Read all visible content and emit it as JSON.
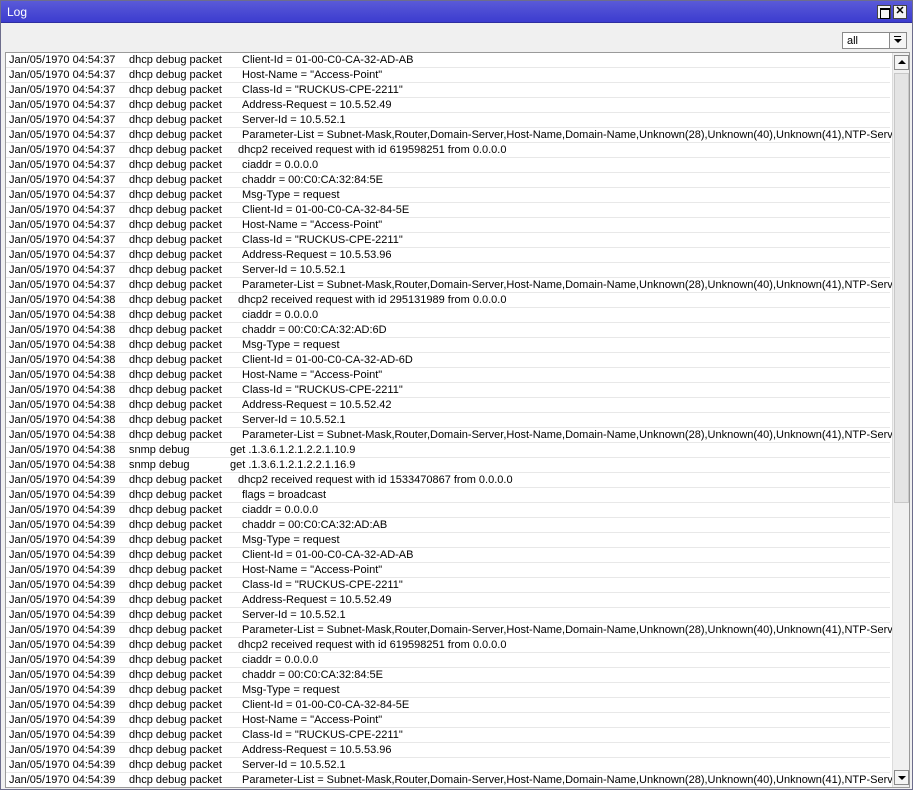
{
  "window": {
    "title": "Log"
  },
  "filter": {
    "value": "all"
  },
  "log": {
    "rows": [
      {
        "time": "Jan/05/1970 04:54:37",
        "topics": "dhcp debug packet",
        "indent": 2,
        "message": "Client-Id = 01-00-C0-CA-32-AD-AB"
      },
      {
        "time": "Jan/05/1970 04:54:37",
        "topics": "dhcp debug packet",
        "indent": 2,
        "message": "Host-Name = \"Access-Point\""
      },
      {
        "time": "Jan/05/1970 04:54:37",
        "topics": "dhcp debug packet",
        "indent": 2,
        "message": "Class-Id = \"RUCKUS-CPE-2211\""
      },
      {
        "time": "Jan/05/1970 04:54:37",
        "topics": "dhcp debug packet",
        "indent": 2,
        "message": "Address-Request = 10.5.52.49"
      },
      {
        "time": "Jan/05/1970 04:54:37",
        "topics": "dhcp debug packet",
        "indent": 2,
        "message": "Server-Id = 10.5.52.1"
      },
      {
        "time": "Jan/05/1970 04:54:37",
        "topics": "dhcp debug packet",
        "indent": 2,
        "message": "Parameter-List = Subnet-Mask,Router,Domain-Server,Host-Name,Domain-Name,Unknown(28),Unknown(40),Unknown(41),NTP-Server"
      },
      {
        "time": "Jan/05/1970 04:54:37",
        "topics": "dhcp debug packet",
        "indent": 1,
        "message": "dhcp2 received request with id 619598251 from 0.0.0.0"
      },
      {
        "time": "Jan/05/1970 04:54:37",
        "topics": "dhcp debug packet",
        "indent": 2,
        "message": "ciaddr = 0.0.0.0"
      },
      {
        "time": "Jan/05/1970 04:54:37",
        "topics": "dhcp debug packet",
        "indent": 2,
        "message": "chaddr = 00:C0:CA:32:84:5E"
      },
      {
        "time": "Jan/05/1970 04:54:37",
        "topics": "dhcp debug packet",
        "indent": 2,
        "message": "Msg-Type = request"
      },
      {
        "time": "Jan/05/1970 04:54:37",
        "topics": "dhcp debug packet",
        "indent": 2,
        "message": "Client-Id = 01-00-C0-CA-32-84-5E"
      },
      {
        "time": "Jan/05/1970 04:54:37",
        "topics": "dhcp debug packet",
        "indent": 2,
        "message": "Host-Name = \"Access-Point\""
      },
      {
        "time": "Jan/05/1970 04:54:37",
        "topics": "dhcp debug packet",
        "indent": 2,
        "message": "Class-Id = \"RUCKUS-CPE-2211\""
      },
      {
        "time": "Jan/05/1970 04:54:37",
        "topics": "dhcp debug packet",
        "indent": 2,
        "message": "Address-Request = 10.5.53.96"
      },
      {
        "time": "Jan/05/1970 04:54:37",
        "topics": "dhcp debug packet",
        "indent": 2,
        "message": "Server-Id = 10.5.52.1"
      },
      {
        "time": "Jan/05/1970 04:54:37",
        "topics": "dhcp debug packet",
        "indent": 2,
        "message": "Parameter-List = Subnet-Mask,Router,Domain-Server,Host-Name,Domain-Name,Unknown(28),Unknown(40),Unknown(41),NTP-Server"
      },
      {
        "time": "Jan/05/1970 04:54:38",
        "topics": "dhcp debug packet",
        "indent": 1,
        "message": "dhcp2 received request with id 295131989 from 0.0.0.0"
      },
      {
        "time": "Jan/05/1970 04:54:38",
        "topics": "dhcp debug packet",
        "indent": 2,
        "message": "ciaddr = 0.0.0.0"
      },
      {
        "time": "Jan/05/1970 04:54:38",
        "topics": "dhcp debug packet",
        "indent": 2,
        "message": "chaddr = 00:C0:CA:32:AD:6D"
      },
      {
        "time": "Jan/05/1970 04:54:38",
        "topics": "dhcp debug packet",
        "indent": 2,
        "message": "Msg-Type = request"
      },
      {
        "time": "Jan/05/1970 04:54:38",
        "topics": "dhcp debug packet",
        "indent": 2,
        "message": "Client-Id = 01-00-C0-CA-32-AD-6D"
      },
      {
        "time": "Jan/05/1970 04:54:38",
        "topics": "dhcp debug packet",
        "indent": 2,
        "message": "Host-Name = \"Access-Point\""
      },
      {
        "time": "Jan/05/1970 04:54:38",
        "topics": "dhcp debug packet",
        "indent": 2,
        "message": "Class-Id = \"RUCKUS-CPE-2211\""
      },
      {
        "time": "Jan/05/1970 04:54:38",
        "topics": "dhcp debug packet",
        "indent": 2,
        "message": "Address-Request = 10.5.52.42"
      },
      {
        "time": "Jan/05/1970 04:54:38",
        "topics": "dhcp debug packet",
        "indent": 2,
        "message": "Server-Id = 10.5.52.1"
      },
      {
        "time": "Jan/05/1970 04:54:38",
        "topics": "dhcp debug packet",
        "indent": 2,
        "message": "Parameter-List = Subnet-Mask,Router,Domain-Server,Host-Name,Domain-Name,Unknown(28),Unknown(40),Unknown(41),NTP-Server"
      },
      {
        "time": "Jan/05/1970 04:54:38",
        "topics": "snmp debug",
        "indent": 0,
        "message": "get .1.3.6.1.2.1.2.2.1.10.9"
      },
      {
        "time": "Jan/05/1970 04:54:38",
        "topics": "snmp debug",
        "indent": 0,
        "message": "get .1.3.6.1.2.1.2.2.1.16.9"
      },
      {
        "time": "Jan/05/1970 04:54:39",
        "topics": "dhcp debug packet",
        "indent": 1,
        "message": "dhcp2 received request with id 1533470867 from 0.0.0.0"
      },
      {
        "time": "Jan/05/1970 04:54:39",
        "topics": "dhcp debug packet",
        "indent": 2,
        "message": "flags = broadcast"
      },
      {
        "time": "Jan/05/1970 04:54:39",
        "topics": "dhcp debug packet",
        "indent": 2,
        "message": "ciaddr = 0.0.0.0"
      },
      {
        "time": "Jan/05/1970 04:54:39",
        "topics": "dhcp debug packet",
        "indent": 2,
        "message": "chaddr = 00:C0:CA:32:AD:AB"
      },
      {
        "time": "Jan/05/1970 04:54:39",
        "topics": "dhcp debug packet",
        "indent": 2,
        "message": "Msg-Type = request"
      },
      {
        "time": "Jan/05/1970 04:54:39",
        "topics": "dhcp debug packet",
        "indent": 2,
        "message": "Client-Id = 01-00-C0-CA-32-AD-AB"
      },
      {
        "time": "Jan/05/1970 04:54:39",
        "topics": "dhcp debug packet",
        "indent": 2,
        "message": "Host-Name = \"Access-Point\""
      },
      {
        "time": "Jan/05/1970 04:54:39",
        "topics": "dhcp debug packet",
        "indent": 2,
        "message": "Class-Id = \"RUCKUS-CPE-2211\""
      },
      {
        "time": "Jan/05/1970 04:54:39",
        "topics": "dhcp debug packet",
        "indent": 2,
        "message": "Address-Request = 10.5.52.49"
      },
      {
        "time": "Jan/05/1970 04:54:39",
        "topics": "dhcp debug packet",
        "indent": 2,
        "message": "Server-Id = 10.5.52.1"
      },
      {
        "time": "Jan/05/1970 04:54:39",
        "topics": "dhcp debug packet",
        "indent": 2,
        "message": "Parameter-List = Subnet-Mask,Router,Domain-Server,Host-Name,Domain-Name,Unknown(28),Unknown(40),Unknown(41),NTP-Server"
      },
      {
        "time": "Jan/05/1970 04:54:39",
        "topics": "dhcp debug packet",
        "indent": 1,
        "message": "dhcp2 received request with id 619598251 from 0.0.0.0"
      },
      {
        "time": "Jan/05/1970 04:54:39",
        "topics": "dhcp debug packet",
        "indent": 2,
        "message": "ciaddr = 0.0.0.0"
      },
      {
        "time": "Jan/05/1970 04:54:39",
        "topics": "dhcp debug packet",
        "indent": 2,
        "message": "chaddr = 00:C0:CA:32:84:5E"
      },
      {
        "time": "Jan/05/1970 04:54:39",
        "topics": "dhcp debug packet",
        "indent": 2,
        "message": "Msg-Type = request"
      },
      {
        "time": "Jan/05/1970 04:54:39",
        "topics": "dhcp debug packet",
        "indent": 2,
        "message": "Client-Id = 01-00-C0-CA-32-84-5E"
      },
      {
        "time": "Jan/05/1970 04:54:39",
        "topics": "dhcp debug packet",
        "indent": 2,
        "message": "Host-Name = \"Access-Point\""
      },
      {
        "time": "Jan/05/1970 04:54:39",
        "topics": "dhcp debug packet",
        "indent": 2,
        "message": "Class-Id = \"RUCKUS-CPE-2211\""
      },
      {
        "time": "Jan/05/1970 04:54:39",
        "topics": "dhcp debug packet",
        "indent": 2,
        "message": "Address-Request = 10.5.53.96"
      },
      {
        "time": "Jan/05/1970 04:54:39",
        "topics": "dhcp debug packet",
        "indent": 2,
        "message": "Server-Id = 10.5.52.1"
      },
      {
        "time": "Jan/05/1970 04:54:39",
        "topics": "dhcp debug packet",
        "indent": 2,
        "message": "Parameter-List = Subnet-Mask,Router,Domain-Server,Host-Name,Domain-Name,Unknown(28),Unknown(40),Unknown(41),NTP-Server"
      }
    ]
  }
}
